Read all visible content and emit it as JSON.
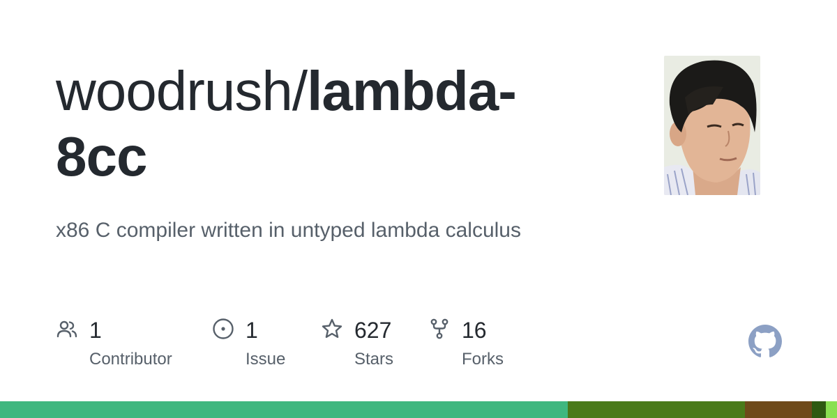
{
  "repo": {
    "owner": "woodrush/",
    "name": "lambda-8cc",
    "description": "x86 C compiler written in untyped lambda calculus"
  },
  "stats": [
    {
      "icon": "people-icon",
      "value": "1",
      "label": "Contributor"
    },
    {
      "icon": "issue-icon",
      "value": "1",
      "label": "Issue"
    },
    {
      "icon": "star-icon",
      "value": "627",
      "label": "Stars"
    },
    {
      "icon": "fork-icon",
      "value": "16",
      "label": "Forks"
    }
  ],
  "colors": {
    "text_primary": "#24292f",
    "text_secondary": "#57606a",
    "icon": "#57606a",
    "github_logo": "#8ca0c4"
  },
  "languages": [
    {
      "color": "#3fb77f",
      "share": 0.678
    },
    {
      "color": "#4a7a1a",
      "share": 0.212
    },
    {
      "color": "#6e4a1a",
      "share": 0.08
    },
    {
      "color": "#2e5a12",
      "share": 0.017
    },
    {
      "color": "#89e051",
      "share": 0.013
    }
  ]
}
